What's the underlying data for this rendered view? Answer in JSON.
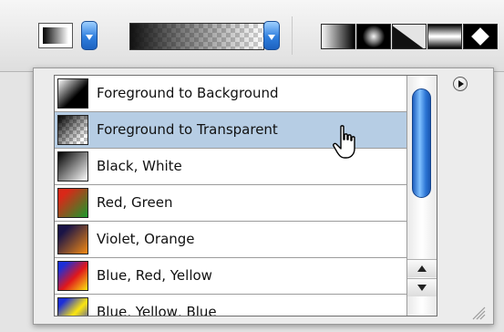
{
  "toolbar": {
    "gradient_preview": "foreground-to-background",
    "picker_preview": "foreground-to-transparent",
    "gradient_types": [
      {
        "name": "linear-gradient-icon"
      },
      {
        "name": "radial-gradient-icon"
      },
      {
        "name": "angle-gradient-icon"
      },
      {
        "name": "reflected-gradient-icon"
      },
      {
        "name": "diamond-gradient-icon"
      }
    ]
  },
  "panel": {
    "presets": [
      {
        "label": "Foreground to Background"
      },
      {
        "label": "Foreground to Transparent"
      },
      {
        "label": "Black, White"
      },
      {
        "label": "Red, Green"
      },
      {
        "label": "Violet, Orange"
      },
      {
        "label": "Blue, Red, Yellow"
      },
      {
        "label": "Blue, Yellow, Blue"
      }
    ],
    "selected_index": 1
  },
  "colors": {
    "selection": "#b6cde4",
    "scroll_thumb": "#2b74d4",
    "dropdown_button": "#2f7fde"
  }
}
